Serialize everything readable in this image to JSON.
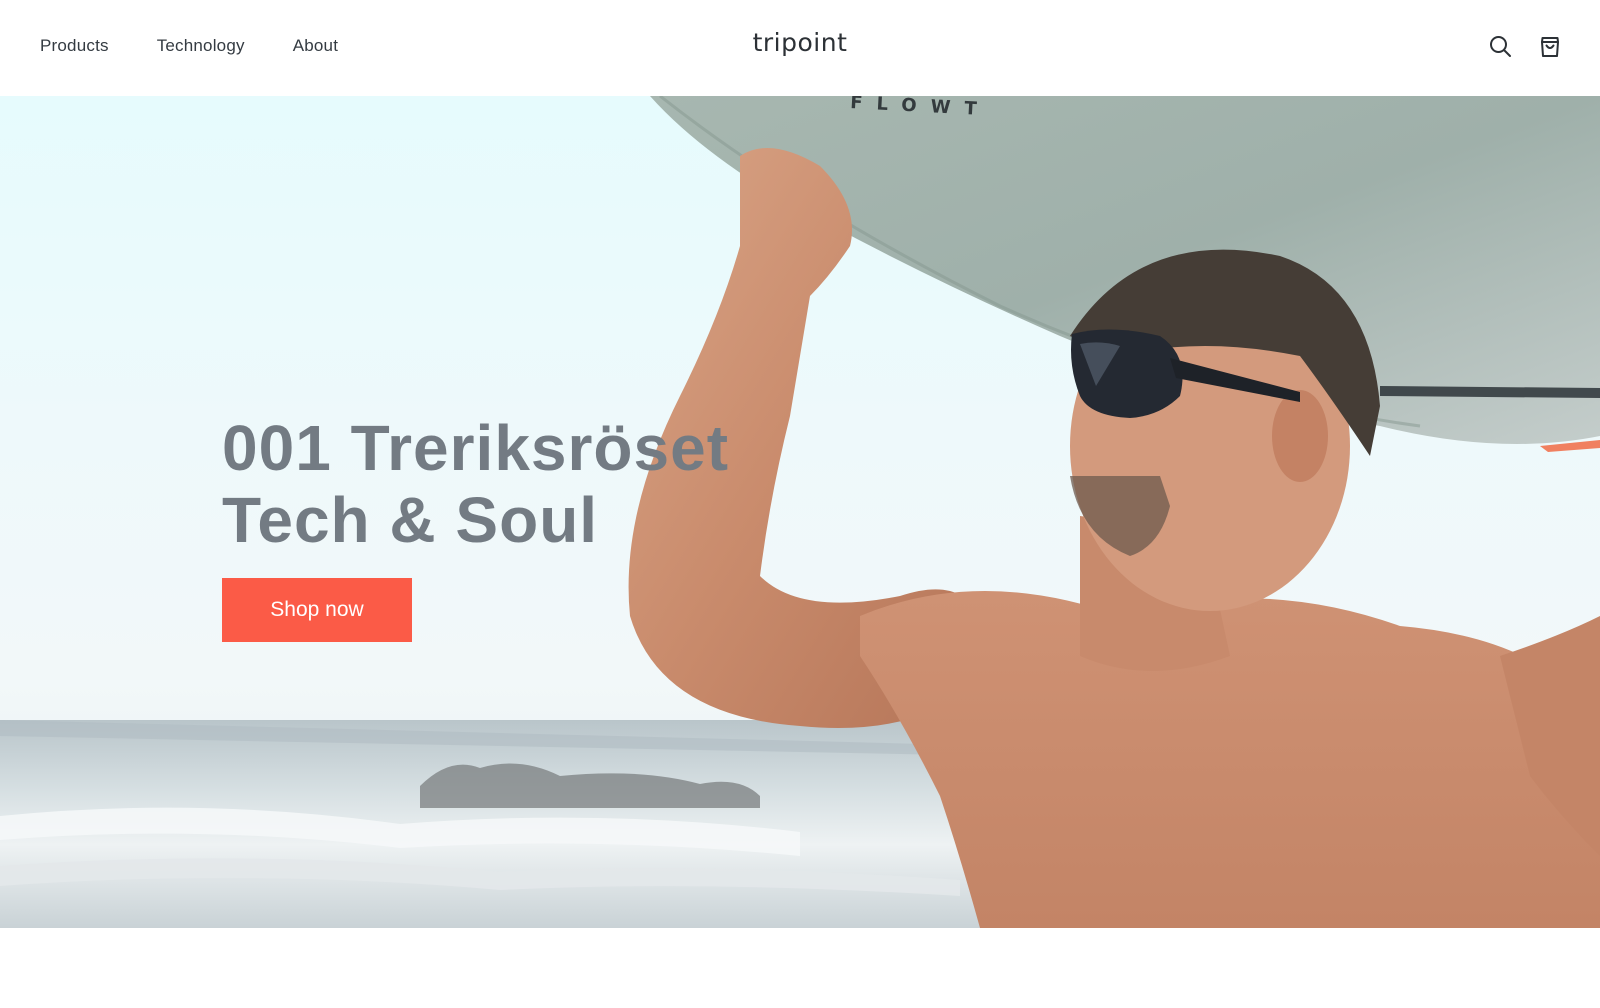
{
  "header": {
    "nav": [
      {
        "label": "Products"
      },
      {
        "label": "Technology"
      },
      {
        "label": "About"
      }
    ],
    "logo": "tripoint",
    "icons": [
      "search-icon",
      "shopping-bag-icon"
    ]
  },
  "hero": {
    "headline_line1": "001 Treriksröset",
    "headline_line2": "Tech & Soul",
    "cta_label": "Shop now",
    "image_subject": "surfer-with-sunglasses-holding-surfboard",
    "board_print": "FLOWT",
    "colors": {
      "cta_background": "#fb5b47",
      "headline_text": "#737b83",
      "sky": "#e6fbfd"
    }
  }
}
